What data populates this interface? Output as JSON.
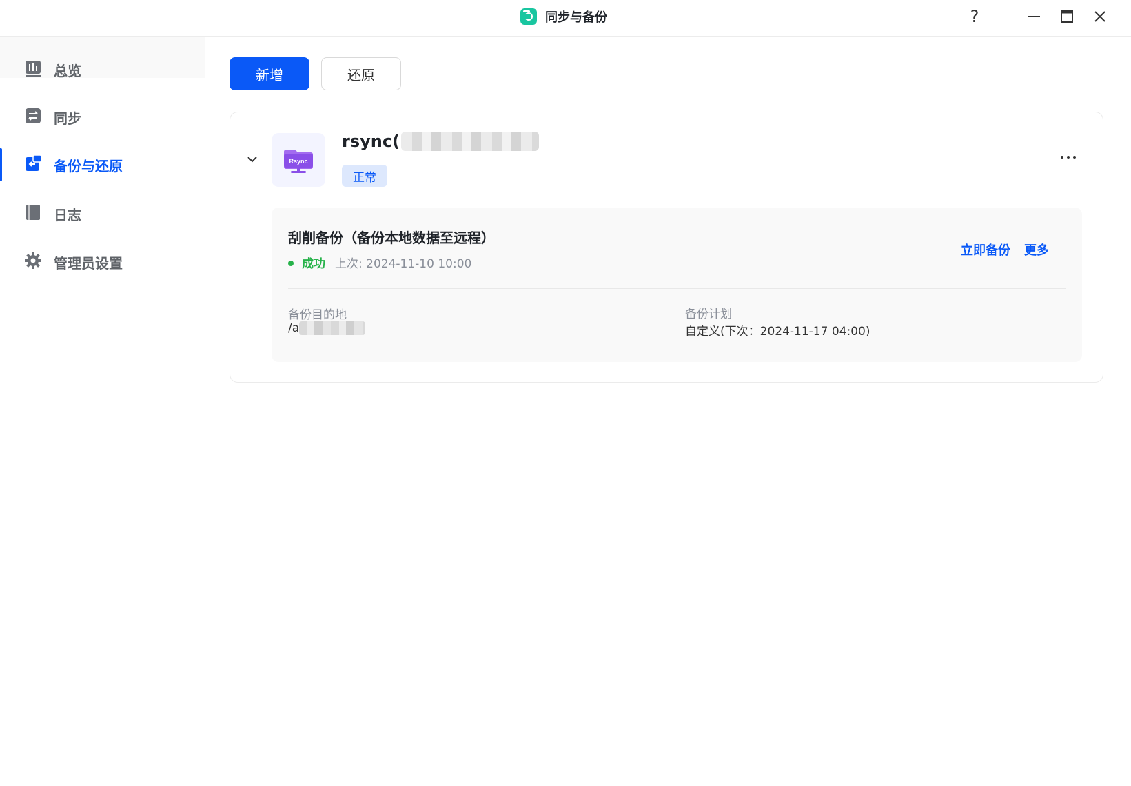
{
  "window": {
    "title": "同步与备份",
    "help_label": "?"
  },
  "sidebar": {
    "items": [
      {
        "label": "总览",
        "icon": "chart-icon"
      },
      {
        "label": "同步",
        "icon": "swap-arrows-icon"
      },
      {
        "label": "备份与还原",
        "icon": "backup-restore-icon",
        "active": true
      },
      {
        "label": "日志",
        "icon": "book-icon"
      },
      {
        "label": "管理员设置",
        "icon": "gear-icon"
      }
    ]
  },
  "toolbar": {
    "add_label": "新增",
    "restore_label": "还原"
  },
  "task": {
    "name_prefix": "rsync(",
    "status": "正常",
    "icon_text": "Rsync",
    "job": {
      "title": "刮削备份（备份本地数据至远程）",
      "result": "成功",
      "last_run": "上次: 2024-11-10 10:00",
      "action_now": "立即备份",
      "action_more": "更多",
      "destination_label": "备份目的地",
      "destination_value_prefix": "/a",
      "schedule_label": "备份计划",
      "schedule_value": "自定义(下次：2024-11-17 04:00)"
    }
  },
  "colors": {
    "accent": "#0a59f7",
    "success": "#27b24a",
    "status_tag_bg": "#dde8fd",
    "app_logo": "#19c6a0"
  }
}
